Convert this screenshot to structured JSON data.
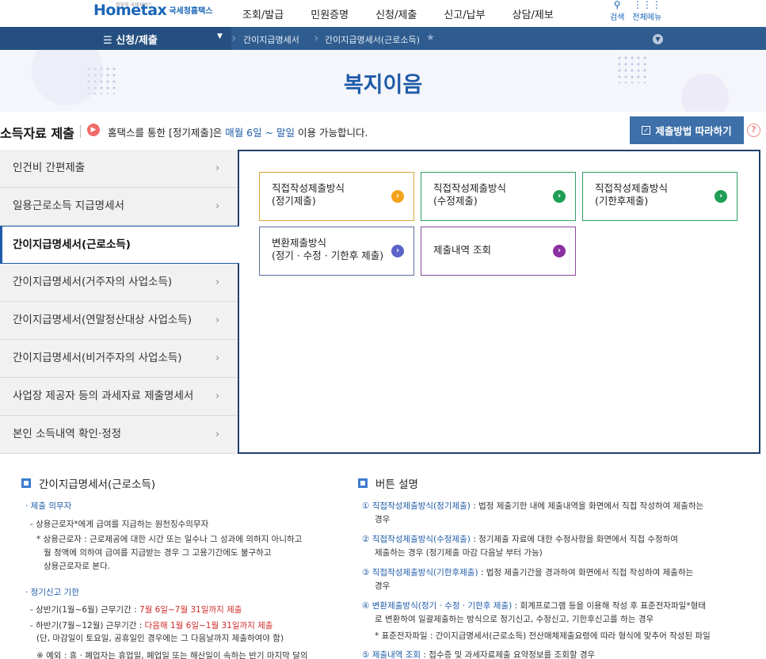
{
  "header": {
    "logo_tiny": "정부의 국세서비스",
    "logo_main": "Hometax",
    "logo_sub": "국세청홈택스",
    "nav": [
      "조회/발급",
      "민원증명",
      "신청/제출",
      "신고/납부",
      "상담/제보"
    ],
    "search_label": "검색",
    "all_menu_label": "전체메뉴"
  },
  "breadcrumb": {
    "menu": "신청/제출",
    "crumbs": [
      "간이지급명세서",
      "간이지급명세서(근로소득)"
    ]
  },
  "hero": {
    "title": "복지이음"
  },
  "section": {
    "title": "소득자료 제출",
    "notice_pre": "홈택스를 통한 [정기제출]은 ",
    "notice_highlight": "매월 6일 ~ 말일",
    "notice_post": " 이용 가능합니다.",
    "follow_button": "제출방법 따라하기",
    "help": "?"
  },
  "sidebar": {
    "items": [
      "인건비 간편제출",
      "일용근로소득 지급명세서",
      "간이지급명세서(근로소득)",
      "간이지급명세서(거주자의 사업소득)",
      "간이지급명세서(연말정산대상 사업소득)",
      "간이지급명세서(비거주자의 사업소득)",
      "사업장 제공자 등의 과세자료 제출명세서",
      "본인 소득내역 확인·정정"
    ],
    "active_index": 2
  },
  "cards": [
    {
      "line1": "직접작성제출방식",
      "line2": "(정기제출)",
      "color": "#f5a21b",
      "border": "#d8a63a"
    },
    {
      "line1": "직접작성제출방식",
      "line2": "(수정제출)",
      "color": "#1f9e55",
      "border": "#2f9e63"
    },
    {
      "line1": "직접작성제출방식",
      "line2": "(기한후제출)",
      "color": "#1f9e55",
      "border": "#2f9e63"
    },
    {
      "line1": "변환제출방식",
      "line2": "(정기 · 수정 · 기한후 제출)",
      "color": "#5b62c9",
      "border": "#5f6f9e"
    },
    {
      "line1": "제출내역 조회",
      "line2": "",
      "color": "#8a2fa0",
      "border": "#8a4a9c"
    }
  ],
  "info_left": {
    "title": "간이지급명세서(근로소득)",
    "duty_head": "· 제출 의무자",
    "duty_1": "- 상용근로자*에게 급여를 지급하는 원천징수의무자",
    "duty_2": "* 상용근로자 : 근로제공에 대한 시간 또는 일수나 그 성과에 의하지 아니하고",
    "duty_3": "월 정액에 의하여 급여를 지급받는 경우 그 고용기간에도 불구하고",
    "duty_4": "상용근로자로 본다.",
    "deadline_head": "· 정기신고 기한",
    "h1_pre": "- 상반기(1월~6월) 근무기간 : ",
    "h1_red": "7월 6일~7월 31일까지 제출",
    "h2_pre": "- 하반기(7월~12월) 근무기간 : ",
    "h2_red": "다음해 1월 6일~1월 31일까지 제출",
    "h2_note": "(단, 마감일이 토요일, 공휴일인 경우에는 그 다음날까지 제출하여야 함)",
    "example": "※ 예외 : 휴 · 폐업자는 휴업일, 폐업일 또는 해산일이 속하는 반기 마지막 달의"
  },
  "info_right": {
    "title": "버튼 설명",
    "b1_num": "①",
    "b1_head": "직접작성제출방식(정기제출)",
    "b1_text": " : 법정 제출기한 내에 제출내역을 화면에서 직접 작성하여 제출하는",
    "b1_text2": "경우",
    "b2_num": "②",
    "b2_head": "직접작성제출방식(수정제출)",
    "b2_text": " : 정기제출 자료에 대한 수정사항을 화면에서 직접 수정하여",
    "b2_text2": "제출하는 경우 (정기제출 마감 다음날 부터 가능)",
    "b3_num": "③",
    "b3_head": "직접작성제출방식(기한후제출)",
    "b3_text": " : 법정 제출기간을 경과하여 화면에서 직접 작성하여 제출하는",
    "b3_text2": "경우",
    "b4_num": "④",
    "b4_head": "변환제출방식(정기 · 수정 · 기한후 제출)",
    "b4_text": " : 회계프로그램 등을 이용해 작성 후 표준전자파일*형태",
    "b4_text2": "로 변환하여 일괄제출하는 방식으로 정기신고, 수정신고, 기한후신고를 하는 경우",
    "b4_note": "* 표준전자파일 : 간이지급명세서(근로소득) 전산매체제출요령에 따라 형식에 맞추어 작성된 파일",
    "b5_num": "⑤",
    "b5_head": "제출내역 조회",
    "b5_text": " : 접수증 및 과세자료제출 요약정보를 조회할 경우"
  }
}
